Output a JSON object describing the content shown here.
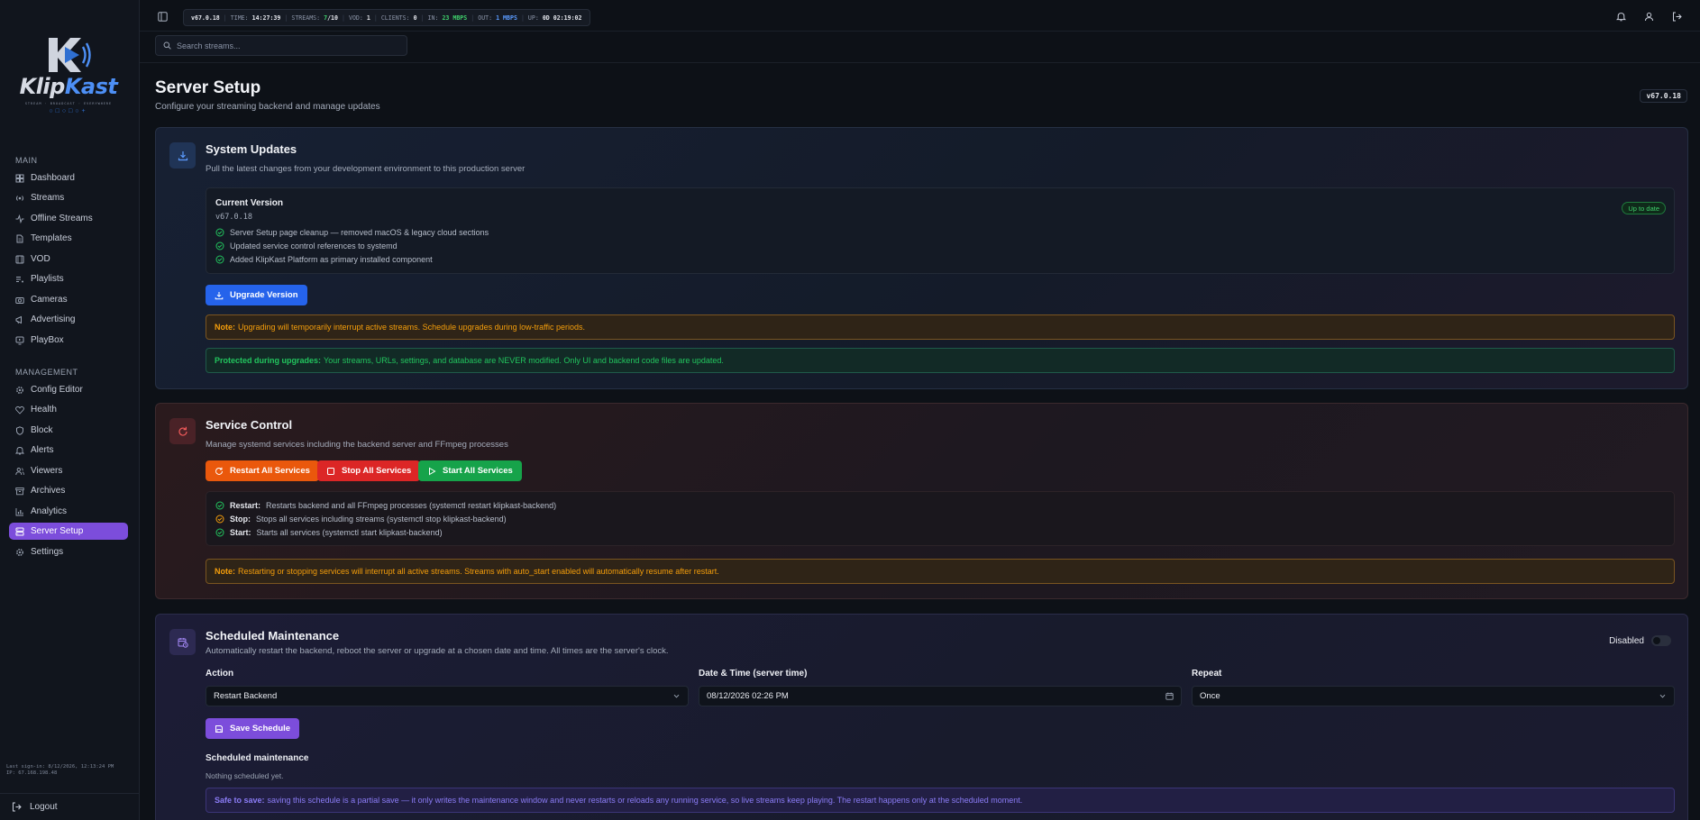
{
  "brand": {
    "name_a": "Klip",
    "name_b": "Kast",
    "tagline": "STREAM · BROADCAST · EVERYWHERE",
    "dots": "○□○□○+"
  },
  "sidebar": {
    "main_header": "MAIN",
    "main_items": [
      {
        "label": "Dashboard",
        "icon": "dashboard-icon"
      },
      {
        "label": "Streams",
        "icon": "radio-icon"
      },
      {
        "label": "Offline Streams",
        "icon": "activity-icon"
      },
      {
        "label": "Templates",
        "icon": "file-icon"
      },
      {
        "label": "VOD",
        "icon": "film-icon"
      },
      {
        "label": "Playlists",
        "icon": "list-music-icon"
      },
      {
        "label": "Cameras",
        "icon": "camera-icon"
      },
      {
        "label": "Advertising",
        "icon": "megaphone-icon"
      },
      {
        "label": "PlayBox",
        "icon": "monitor-play-icon"
      }
    ],
    "management_header": "MANAGEMENT",
    "management_items": [
      {
        "label": "Config Editor",
        "icon": "gear-icon"
      },
      {
        "label": "Health",
        "icon": "heart-pulse-icon"
      },
      {
        "label": "Block",
        "icon": "shield-icon"
      },
      {
        "label": "Alerts",
        "icon": "bell-icon"
      },
      {
        "label": "Viewers",
        "icon": "users-icon"
      },
      {
        "label": "Archives",
        "icon": "archive-icon"
      },
      {
        "label": "Analytics",
        "icon": "bar-chart-icon"
      },
      {
        "label": "Server Setup",
        "icon": "server-icon",
        "active": true
      },
      {
        "label": "Settings",
        "icon": "settings-icon"
      }
    ],
    "last_signin": "Last sign-in: 8/12/2026, 12:13:24 PM",
    "ip": "IP: 67.168.198.48",
    "logout_label": "Logout"
  },
  "topbar": {
    "version": "v67.0.18",
    "time_label": "TIME:",
    "time_value": "14:27:39",
    "streams_label": "STREAMS:",
    "streams_active": "7",
    "streams_total": "/10",
    "vod_label": "VOD:",
    "vod_value": "1",
    "clients_label": "CLIENTS:",
    "clients_value": "0",
    "in_label": "IN:",
    "in_value": "23 MBPS",
    "out_label": "OUT:",
    "out_value": "1 MBPS",
    "up_label": "UP:",
    "up_value": "0D 02:19:02",
    "search_placeholder": "Search streams..."
  },
  "page": {
    "title": "Server Setup",
    "subtitle": "Configure your streaming backend and manage updates",
    "version_badge": "v67.0.18"
  },
  "updates": {
    "title": "System Updates",
    "desc": "Pull the latest changes from your development environment to this production server",
    "current_label": "Current Version",
    "current_value": "v67.0.18",
    "status_badge": "Up to date",
    "changes": [
      "Server Setup page cleanup — removed macOS & legacy cloud sections",
      "Updated service control references to systemd",
      "Added KlipKast Platform as primary installed component"
    ],
    "upgrade_label": "Upgrade Version",
    "note_bold": "Note:",
    "note_text": "Upgrading will temporarily interrupt active streams. Schedule upgrades during low-traffic periods.",
    "protected_bold": "Protected during upgrades:",
    "protected_text": "Your streams, URLs, settings, and database are NEVER modified. Only UI and backend code files are updated."
  },
  "service": {
    "title": "Service Control",
    "desc": "Manage systemd services including the backend server and FFmpeg processes",
    "restart_label": "Restart All Services",
    "stop_label": "Stop All Services",
    "start_label": "Start All Services",
    "items": [
      {
        "bold": "Restart:",
        "text": "Restarts backend and all FFmpeg processes (systemctl restart klipkast-backend)",
        "color": "#22c55e"
      },
      {
        "bold": "Stop:",
        "text": "Stops all services including streams (systemctl stop klipkast-backend)",
        "color": "#f59e0b"
      },
      {
        "bold": "Start:",
        "text": "Starts all services (systemctl start klipkast-backend)",
        "color": "#22c55e"
      }
    ],
    "note_bold": "Note:",
    "note_text": "Restarting or stopping services will interrupt all active streams. Streams with auto_start enabled will automatically resume after restart."
  },
  "maintenance": {
    "title": "Scheduled Maintenance",
    "desc": "Automatically restart the backend, reboot the server or upgrade at a chosen date and time. All times are the server's clock.",
    "toggle_label": "Disabled",
    "action_label": "Action",
    "action_value": "Restart Backend",
    "datetime_label": "Date & Time (server time)",
    "datetime_value": "08/12/2026 02:26 PM",
    "repeat_label": "Repeat",
    "repeat_value": "Once",
    "save_label": "Save Schedule",
    "scheduled_label": "Scheduled maintenance",
    "scheduled_empty": "Nothing scheduled yet.",
    "safe_bold": "Safe to save:",
    "safe_text": "saving this schedule is a partial save — it only writes the maintenance window and never restarts or reloads any running service, so live streams keep playing. The restart happens only at the scheduled moment."
  }
}
